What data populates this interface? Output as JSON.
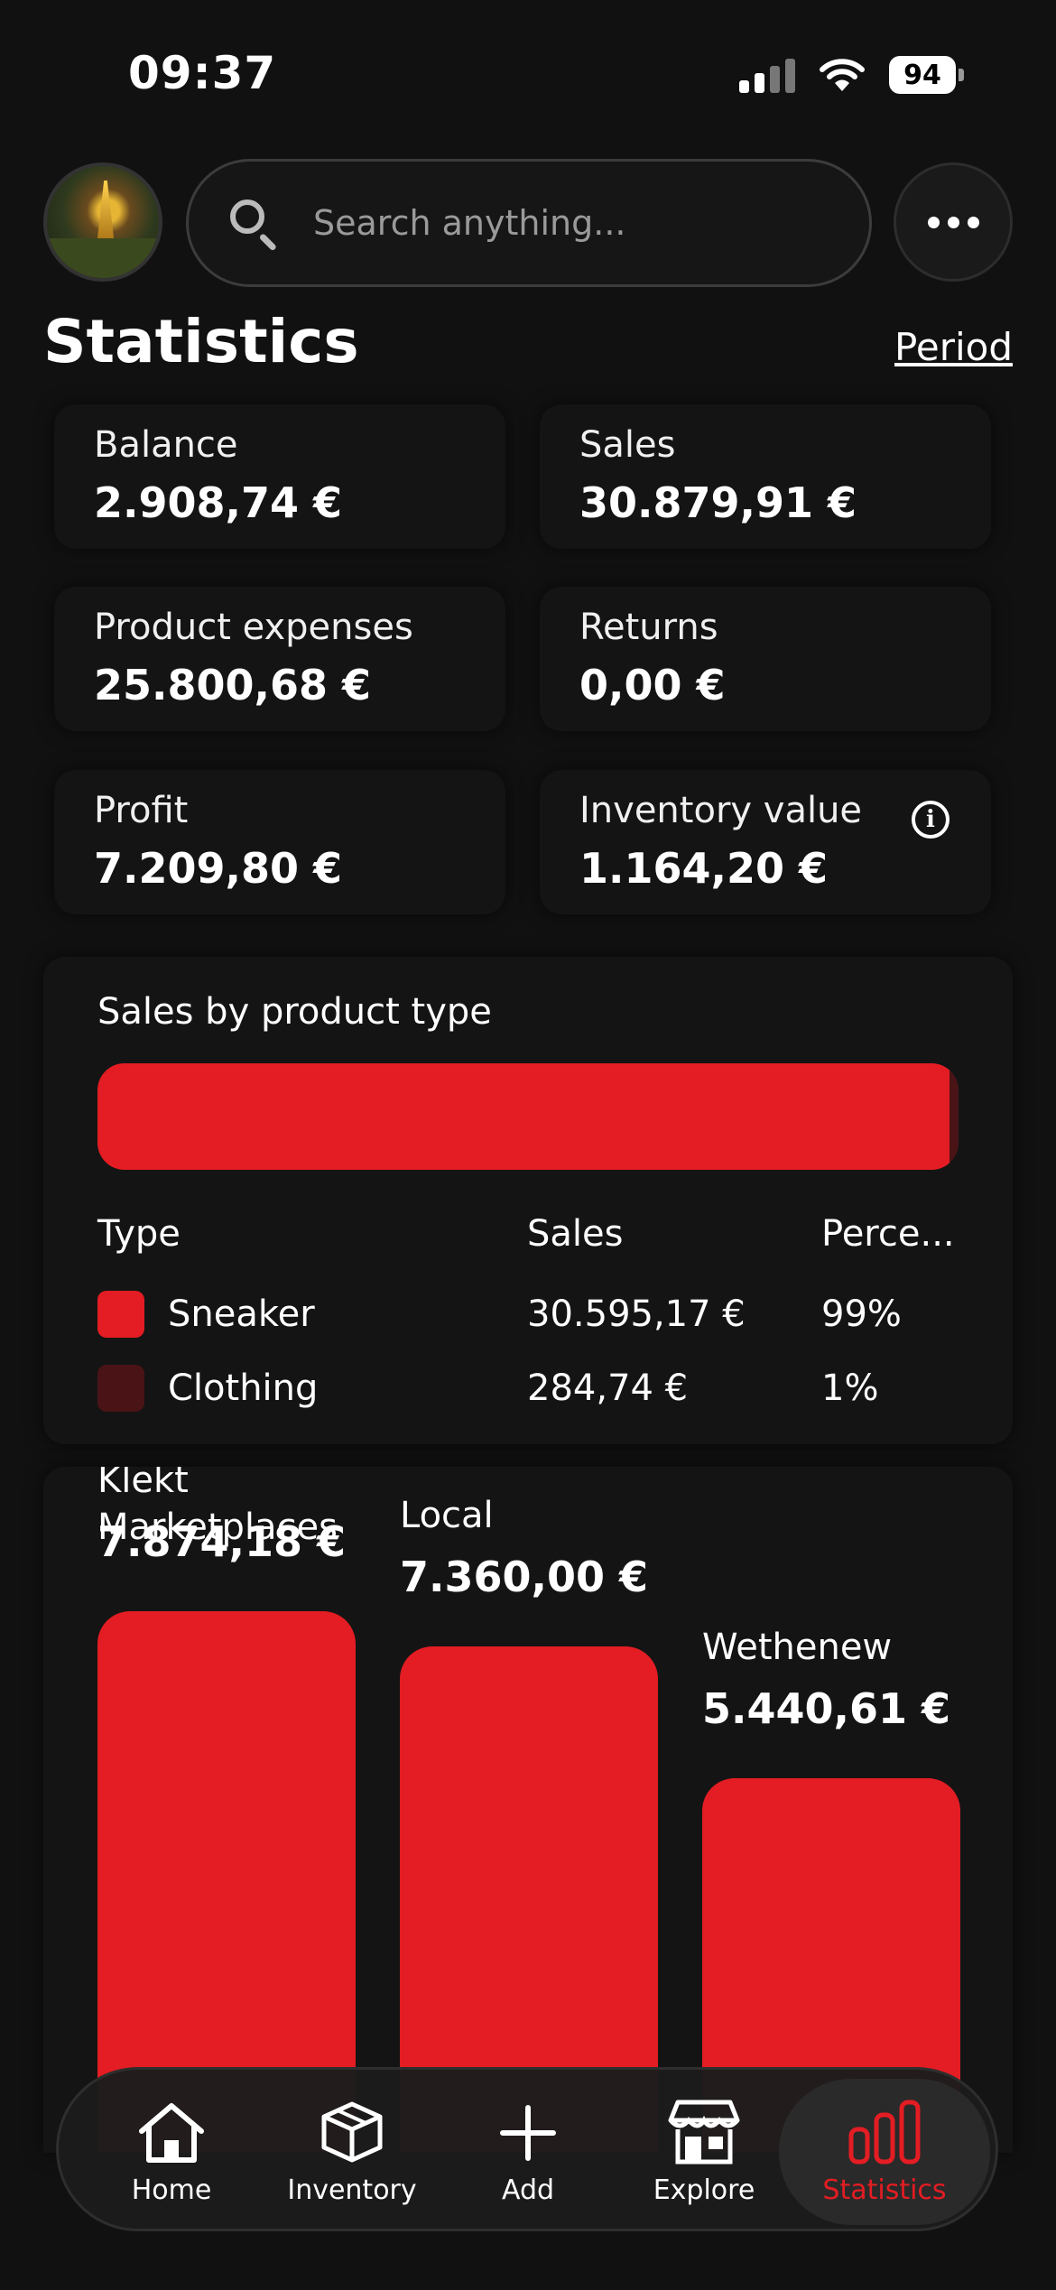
{
  "status_bar": {
    "time": "09:37",
    "battery": "94"
  },
  "header": {
    "search_placeholder": "Search anything...",
    "title": "Statistics",
    "period_link": "Period"
  },
  "stats": [
    {
      "label": "Balance",
      "value": "2.908,74 €"
    },
    {
      "label": "Sales",
      "value": "30.879,91 €"
    },
    {
      "label": "Product expenses",
      "value": "25.800,68 €"
    },
    {
      "label": "Returns",
      "value": "0,00 €"
    },
    {
      "label": "Profit",
      "value": "7.209,80 €"
    },
    {
      "label": "Inventory value",
      "value": "1.164,20 €",
      "info_icon": "info-icon"
    }
  ],
  "sales_by_type": {
    "title": "Sales by product type",
    "columns": [
      "Type",
      "Sales",
      "Perce..."
    ],
    "rows": [
      {
        "type": "Sneaker",
        "sales": "30.595,17 €",
        "percent": "99%",
        "share": 0.99,
        "color": "#e31d23"
      },
      {
        "type": "Clothing",
        "sales": "284,74 €",
        "percent": "1%",
        "share": 0.01,
        "color": "#4a1416"
      }
    ]
  },
  "marketplaces": {
    "title": "Marketplaces",
    "items": [
      {
        "name": "Klekt",
        "value": "7.874,18 €",
        "amount": 7874.18
      },
      {
        "name": "Local",
        "value": "7.360,00 €",
        "amount": 7360.0
      },
      {
        "name": "Wethenew",
        "value": "5.440,61 €",
        "amount": 5440.61
      }
    ]
  },
  "nav": {
    "items": [
      {
        "label": "Home",
        "icon": "home-icon"
      },
      {
        "label": "Inventory",
        "icon": "box-icon"
      },
      {
        "label": "Add",
        "icon": "plus-icon"
      },
      {
        "label": "Explore",
        "icon": "store-icon"
      },
      {
        "label": "Statistics",
        "icon": "bar-chart-icon",
        "active": true
      }
    ]
  },
  "colors": {
    "background": "#111111",
    "card": "#141414",
    "accent": "#e31d23",
    "accent_dark": "#4a1416"
  }
}
